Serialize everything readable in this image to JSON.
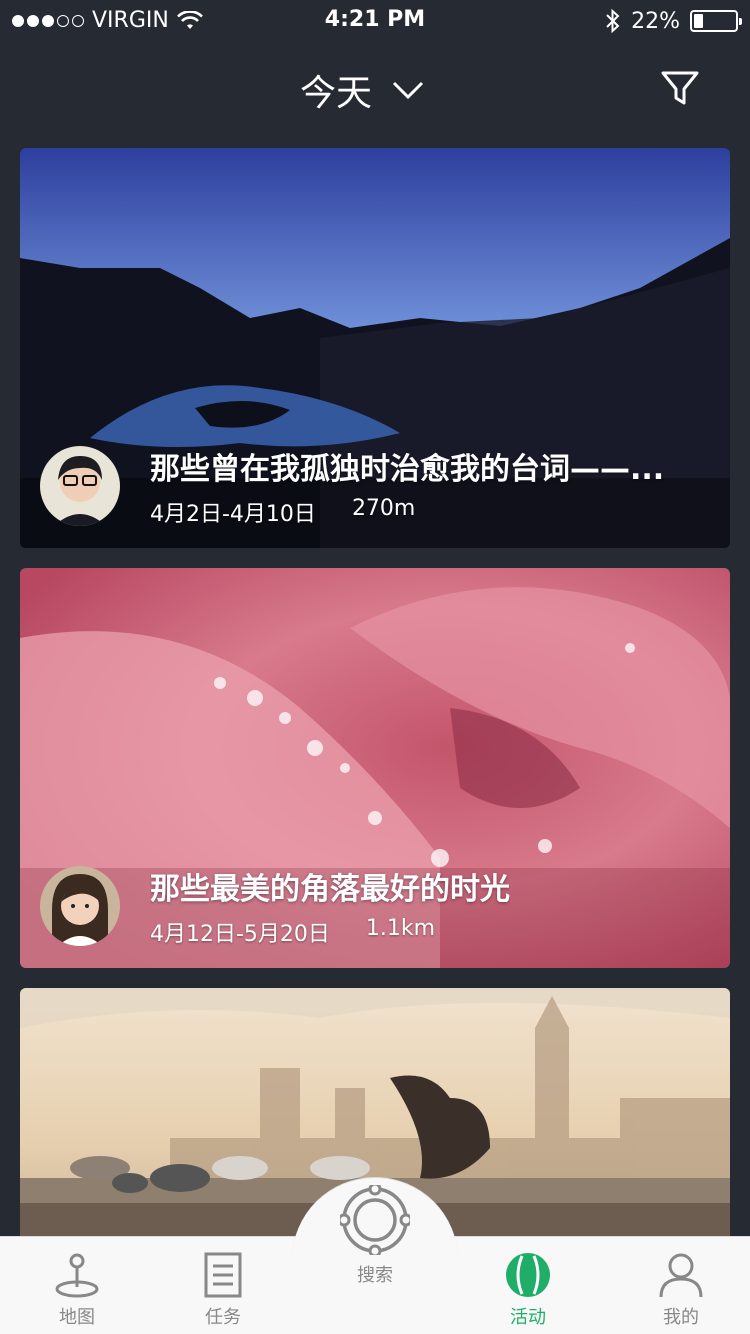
{
  "status_bar": {
    "carrier": "VIRGIN",
    "time": "4:21 PM",
    "battery_text": "22%",
    "battery_level": 0.22
  },
  "header": {
    "title": "今天"
  },
  "cards": [
    {
      "title": "那些曾在我孤独时治愈我的台词——...",
      "date_range": "4月2日-4月10日",
      "distance": "270m"
    },
    {
      "title": "那些最美的角落最好的时光",
      "date_range": "4月12日-5月20日",
      "distance": "1.1km"
    },
    {
      "title": "",
      "date_range": "",
      "distance": ""
    }
  ],
  "tab_bar": {
    "items": [
      {
        "label": "地图",
        "icon": "map-pin-icon"
      },
      {
        "label": "任务",
        "icon": "document-icon"
      },
      {
        "label": "搜索",
        "icon": "search-target-icon"
      },
      {
        "label": "活动",
        "icon": "ball-icon"
      },
      {
        "label": "我的",
        "icon": "person-icon"
      }
    ],
    "active_index": 3,
    "accent_color": "#1fae67"
  }
}
